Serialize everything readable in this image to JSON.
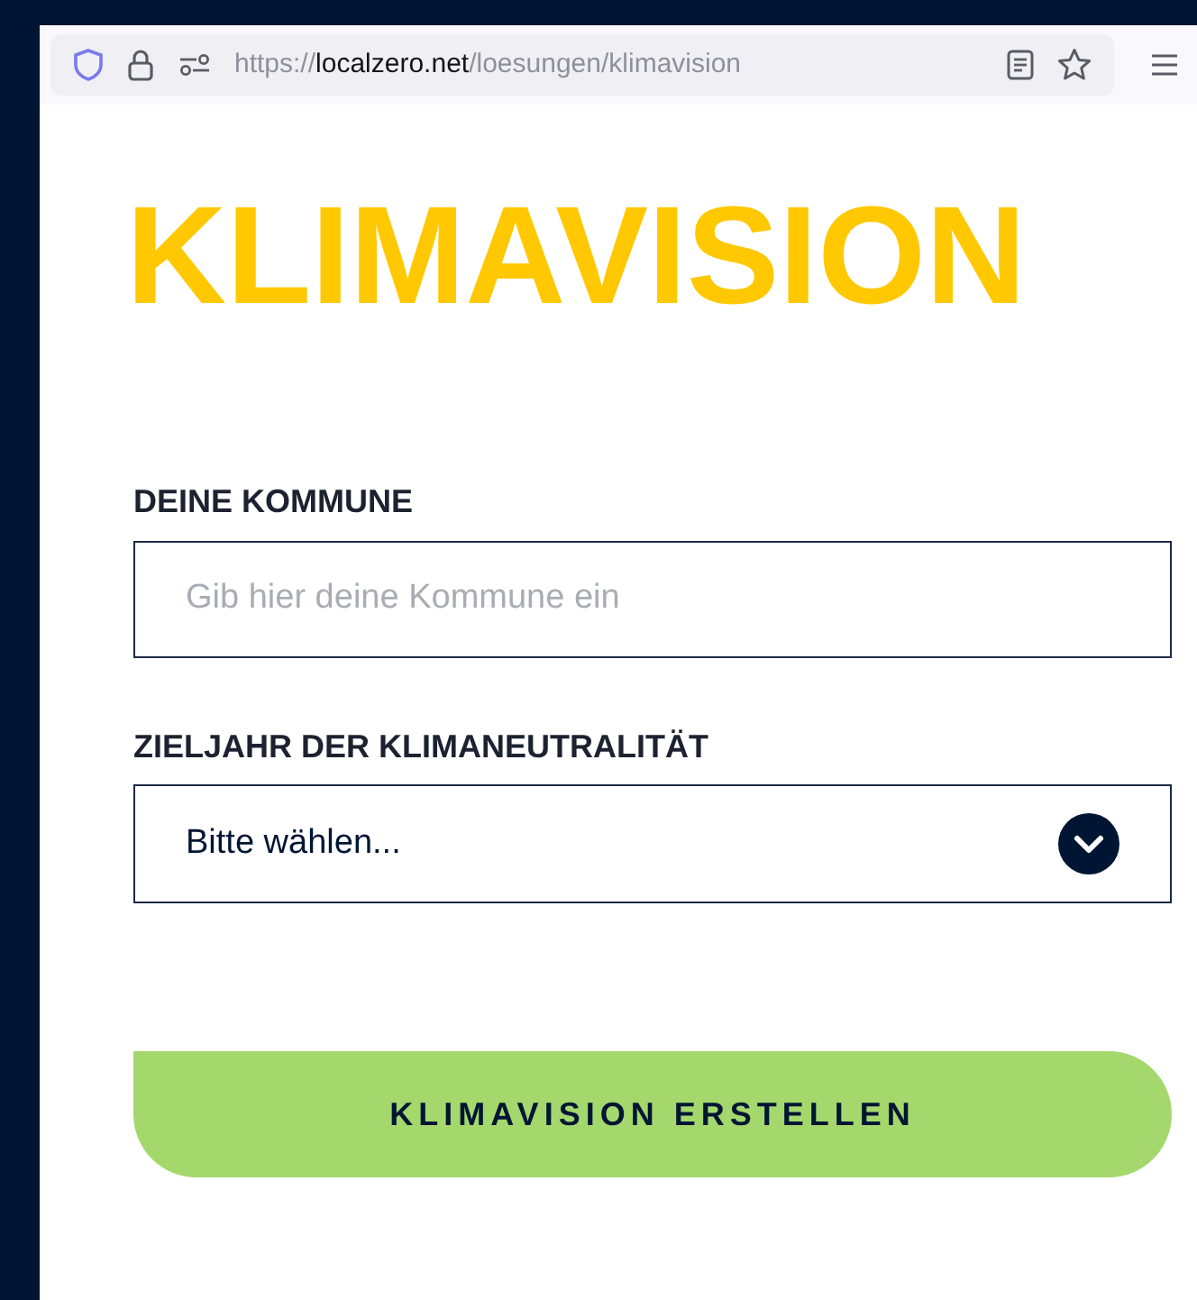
{
  "browser": {
    "address": {
      "scheme": "https://",
      "domain": "localzero.net",
      "path": "/loesungen/klimavision"
    }
  },
  "page": {
    "title": "KLIMAVISION",
    "fields": [
      {
        "kind": "text",
        "label": "DEINE KOMMUNE",
        "placeholder": "Gib hier deine Kommune ein"
      },
      {
        "kind": "select",
        "label": "ZIELJAHR DER KLIMANEUTRALITÄT",
        "value": "Bitte wählen..."
      }
    ],
    "submit": "KLIMAVISION ERSTELLEN"
  }
}
